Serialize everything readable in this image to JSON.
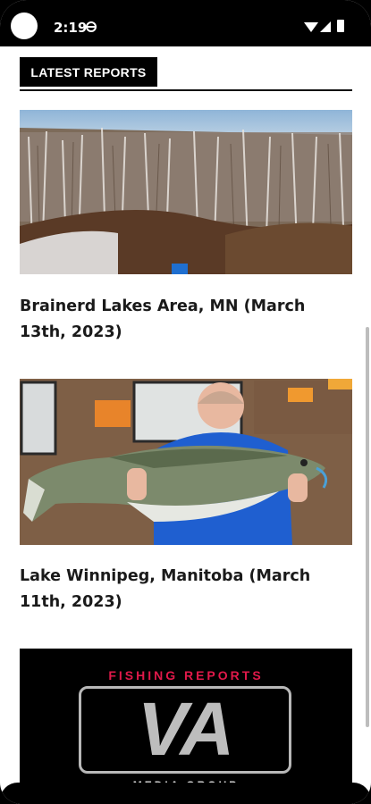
{
  "status_bar": {
    "time": "2:19",
    "icons": [
      "globe-icon",
      "wifi-icon",
      "signal-icon",
      "battery-icon"
    ]
  },
  "section": {
    "title": "LATEST REPORTS"
  },
  "reports": [
    {
      "image": "winter-forest-hillside-photo",
      "title": "Brainerd Lakes Area, MN (March 13th, 2023)"
    },
    {
      "image": "angler-holding-walleye-photo",
      "title": "Lake Winnipeg, Manitoba (March 11th, 2023)"
    }
  ],
  "ad": {
    "label": "FISHING REPORTS",
    "logo": "VA",
    "subtitle": "MEDIA GROUP",
    "accent_color": "#e0194a"
  },
  "colors": {
    "header_bg": "#000000",
    "text": "#1a1a1a",
    "background": "#ffffff"
  }
}
